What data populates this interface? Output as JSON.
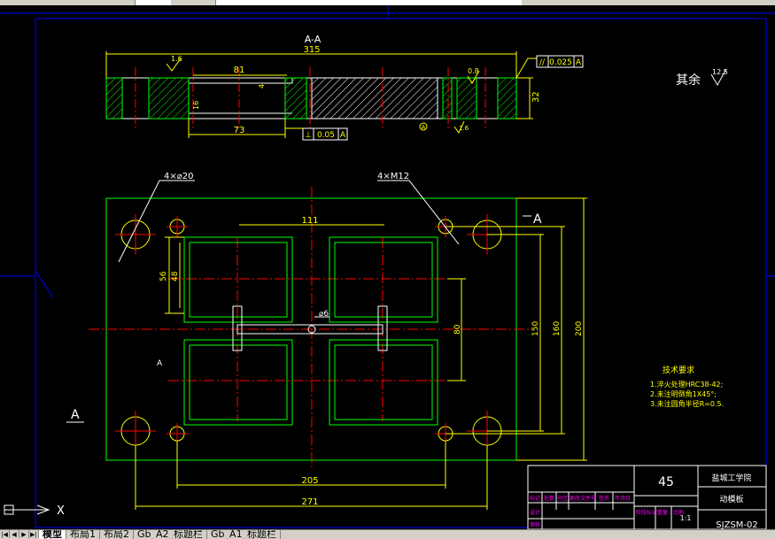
{
  "section_title": "A-A",
  "section_dims": {
    "overall_width": "315",
    "pocket_width": "81",
    "pocket_depth": "4",
    "hole_depth": "16",
    "recess_width": "73",
    "thickness": "32",
    "surface_finish_left": "1.6",
    "surface_finish_right": "0.8",
    "datum_mark": "A",
    "surface_finish_small": "1.6"
  },
  "tolerances": {
    "parallel_symbol": "//",
    "parallel_value": "0.025",
    "parallel_datum": "A",
    "perp_symbol": "⊥",
    "perp_value": "0.05",
    "perp_datum": "A"
  },
  "roughness_note": {
    "label": "其余",
    "value": "12.5"
  },
  "plan_labels": {
    "holes_large": "4×⌀20",
    "holes_threaded": "4×M12",
    "dim_111": "111",
    "dim_56": "56",
    "dim_48": "48",
    "dim_150": "150",
    "dim_160": "160",
    "dim_200": "200",
    "dim_phi6": "⌀6",
    "dim_80": "80",
    "dim_205": "205",
    "dim_271": "271",
    "section_mark_top": "A",
    "section_mark_bottom": "A",
    "section_mark_left": "A"
  },
  "tech_requirements": {
    "title": "技术要求",
    "lines": [
      "1.淬火处理HRC38-42;",
      "2.未注明倒角1X45°;",
      "3.未注圆角半径R=0.5."
    ]
  },
  "title_block": {
    "material": "45",
    "school": "盐城工学院",
    "part_name": "动模板",
    "drawing_no": "SJZSM-02",
    "scale": "1:1",
    "rev_headers": [
      "标记",
      "处数",
      "分区",
      "更改文件号",
      "签名",
      "年月日"
    ],
    "role_rows": [
      "设计",
      "审核"
    ],
    "stage_headers": [
      "阶段标记",
      "重量",
      "比例"
    ]
  },
  "ucs": {
    "x_label": "X"
  },
  "tabs": [
    "模型",
    "布局1",
    "布局2",
    "Gb_A2_标题栏",
    "Gb_A1_标题栏"
  ],
  "active_tab": 0
}
